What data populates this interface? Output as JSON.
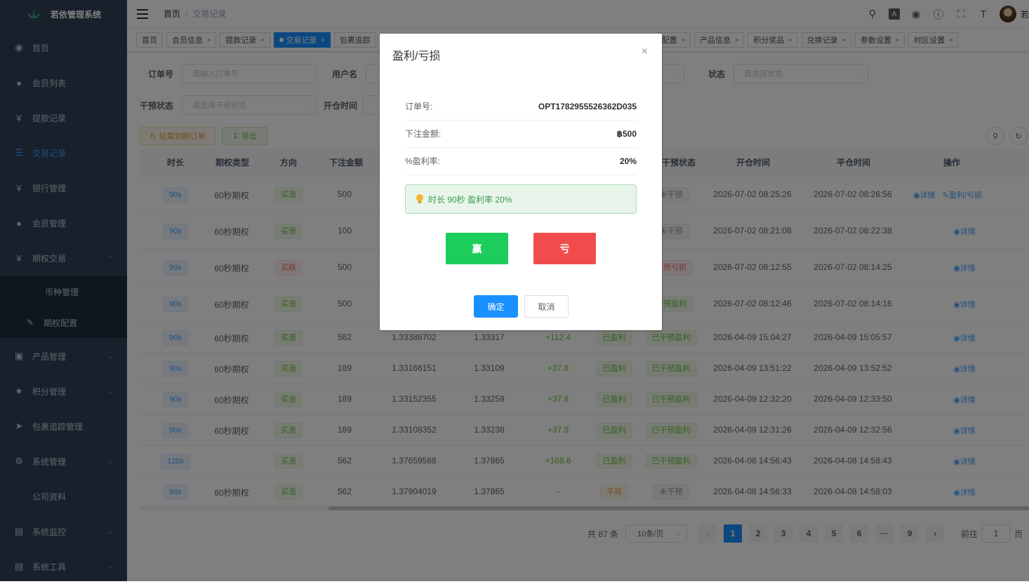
{
  "app": {
    "title": "若依管理系统"
  },
  "sidebar": {
    "items": [
      {
        "label": "首页",
        "icon": "dashboard-icon"
      },
      {
        "label": "会员列表",
        "icon": "user-icon"
      },
      {
        "label": "提款记录",
        "icon": "yen-icon"
      },
      {
        "label": "交易记录",
        "icon": "list-icon"
      },
      {
        "label": "银行管理",
        "icon": "yen-icon"
      },
      {
        "label": "会员管理",
        "icon": "peoples-icon"
      },
      {
        "label": "期权交易",
        "icon": "yen-icon"
      },
      {
        "label": "产品管理",
        "icon": "cart-icon"
      },
      {
        "label": "积分管理",
        "icon": "star-icon"
      },
      {
        "label": "包裹追踪管理",
        "icon": "send-icon"
      },
      {
        "label": "系统管理",
        "icon": "gear-icon"
      },
      {
        "label": "公司资料",
        "icon": ""
      },
      {
        "label": "系统监控",
        "icon": "monitor-icon"
      },
      {
        "label": "系统工具",
        "icon": "tool-icon"
      }
    ],
    "sub_items": [
      {
        "label": "币种管理"
      },
      {
        "label": "期权配置"
      }
    ]
  },
  "breadcrumb": {
    "home": "首页",
    "current": "交易记录"
  },
  "tags": [
    {
      "label": "首页",
      "closable": false
    },
    {
      "label": "会员信息",
      "closable": true
    },
    {
      "label": "提款记录",
      "closable": true
    },
    {
      "label": "交易记录",
      "closable": true,
      "active": true
    },
    {
      "label": "包裹追踪",
      "closable": false
    },
    {
      "label": "配置",
      "closable": true
    },
    {
      "label": "产品信息",
      "closable": true
    },
    {
      "label": "积分奖品",
      "closable": true
    },
    {
      "label": "兑换记录",
      "closable": true
    },
    {
      "label": "参数设置",
      "closable": true
    },
    {
      "label": "时区设置",
      "closable": true
    }
  ],
  "search": {
    "order_label": "订单号",
    "order_placeholder": "请输入订单号",
    "user_label": "用户名",
    "status_label": "状态",
    "status_placeholder": "请选择状态",
    "intervene_label": "干预状态",
    "intervene_placeholder": "请选择干预状态",
    "open_time_label": "开仓时间"
  },
  "toolbar": {
    "settle_label": "结算到期订单",
    "export_label": "导出"
  },
  "table": {
    "headers": [
      "时长",
      "期权类型",
      "方向",
      "下注金额",
      "干预状态",
      "开仓时间",
      "平仓时间",
      "操作"
    ],
    "rows": [
      {
        "duration": "90s",
        "type": "60秒期权",
        "direction": "买涨",
        "dir_class": "b-green",
        "amount": "500",
        "open_price": "",
        "close_price": "",
        "pnl": "",
        "status": "",
        "status_class": "",
        "intervene": "未干预",
        "intervene_class": "b-gray",
        "open_time": "2026-07-02 08:25:26",
        "close_time": "2026-07-02 08:26:56",
        "detail": "详情",
        "pnl_action": "盈利/亏损"
      },
      {
        "duration": "90s",
        "type": "60秒期权",
        "direction": "买涨",
        "dir_class": "b-green",
        "amount": "100",
        "open_price": "",
        "close_price": "",
        "pnl": "",
        "status": "",
        "status_class": "",
        "intervene": "未干预",
        "intervene_class": "b-gray",
        "open_time": "2026-07-02 08:21:08",
        "close_time": "2026-07-02 08:22:38",
        "detail": "详情",
        "pnl_action": ""
      },
      {
        "duration": "90s",
        "type": "60秒期权",
        "direction": "买跌",
        "dir_class": "b-red",
        "amount": "500",
        "open_price": "",
        "close_price": "",
        "pnl": "",
        "status": "",
        "status_class": "",
        "intervene": "干预亏损",
        "intervene_class": "b-red",
        "open_time": "2026-07-02 08:12:55",
        "close_time": "2026-07-02 08:14:25",
        "detail": "详情",
        "pnl_action": ""
      },
      {
        "duration": "90s",
        "type": "60秒期权",
        "direction": "买涨",
        "dir_class": "b-green",
        "amount": "500",
        "open_price": "",
        "close_price": "",
        "pnl": "",
        "status": "",
        "status_class": "",
        "intervene": "干预盈利",
        "intervene_class": "b-green",
        "open_time": "2026-07-02 08:12:46",
        "close_time": "2026-07-02 08:14:16",
        "detail": "详情",
        "pnl_action": ""
      },
      {
        "duration": "90s",
        "type": "60秒期权",
        "direction": "买涨",
        "dir_class": "b-green",
        "amount": "562",
        "open_price": "1.33388702",
        "close_price": "1.33317",
        "pnl": "+112.4",
        "status": "已盈利",
        "status_class": "b-green",
        "intervene": "已干预盈利",
        "intervene_class": "b-green",
        "open_time": "2026-04-09 15:04:27",
        "close_time": "2026-04-09 15:05:57",
        "detail": "详情",
        "pnl_action": ""
      },
      {
        "duration": "90s",
        "type": "60秒期权",
        "direction": "买涨",
        "dir_class": "b-green",
        "amount": "189",
        "open_price": "1.33166151",
        "close_price": "1.33109",
        "pnl": "+37.8",
        "status": "已盈利",
        "status_class": "b-green",
        "intervene": "已干预盈利",
        "intervene_class": "b-green",
        "open_time": "2026-04-09 13:51:22",
        "close_time": "2026-04-09 13:52:52",
        "detail": "详情",
        "pnl_action": ""
      },
      {
        "duration": "90s",
        "type": "60秒期权",
        "direction": "买涨",
        "dir_class": "b-green",
        "amount": "189",
        "open_price": "1.33152355",
        "close_price": "1.33259",
        "pnl": "+37.8",
        "status": "已盈利",
        "status_class": "b-green",
        "intervene": "已干预盈利",
        "intervene_class": "b-green",
        "open_time": "2026-04-09 12:32:20",
        "close_time": "2026-04-09 12:33:50",
        "detail": "详情",
        "pnl_action": ""
      },
      {
        "duration": "90s",
        "type": "60秒期权",
        "direction": "买涨",
        "dir_class": "b-green",
        "amount": "189",
        "open_price": "1.33108352",
        "close_price": "1.33238",
        "pnl": "+37.8",
        "status": "已盈利",
        "status_class": "b-green",
        "intervene": "已干预盈利",
        "intervene_class": "b-green",
        "open_time": "2026-04-09 12:31:26",
        "close_time": "2026-04-09 12:32:56",
        "detail": "详情",
        "pnl_action": ""
      },
      {
        "duration": "120s",
        "type": "",
        "direction": "买涨",
        "dir_class": "b-green",
        "amount": "562",
        "open_price": "1.37659588",
        "close_price": "1.37865",
        "pnl": "+168.6",
        "status": "已盈利",
        "status_class": "b-green",
        "intervene": "已干预盈利",
        "intervene_class": "b-green",
        "open_time": "2026-04-08 14:56:43",
        "close_time": "2026-04-08 14:58:43",
        "detail": "详情",
        "pnl_action": ""
      },
      {
        "duration": "90s",
        "type": "60秒期权",
        "direction": "买涨",
        "dir_class": "b-green",
        "amount": "562",
        "open_price": "1.37904019",
        "close_price": "1.37865",
        "pnl": "-",
        "status": "平局",
        "status_class": "b-yellow",
        "intervene": "未干预",
        "intervene_class": "b-gray",
        "open_time": "2026-04-08 14:56:33",
        "close_time": "2026-04-08 14:58:03",
        "detail": "详情",
        "pnl_action": ""
      }
    ]
  },
  "pagination": {
    "total": "共 87 条",
    "size": "10条/页",
    "pages": [
      "1",
      "2",
      "3",
      "4",
      "5",
      "6",
      "···",
      "9"
    ],
    "current": "1",
    "jump_label": "前往",
    "jump_value": "1",
    "page_unit": "页"
  },
  "dialog": {
    "title": "盈利/亏损",
    "order_label": "订单号:",
    "order_value": "OPT1782955526362D035",
    "amount_label": "下注金额:",
    "amount_value": "฿500",
    "rate_label": "%盈利率:",
    "rate_value": "20%",
    "tip": "时长 90秒 盈利率 20%",
    "win_label": "赢",
    "lose_label": "亏",
    "ok_label": "确定",
    "cancel_label": "取消"
  },
  "colors": {
    "primary": "#1890ff",
    "sidebar": "#304156",
    "win": "#1ccd5c",
    "lose": "#f24b4b"
  }
}
